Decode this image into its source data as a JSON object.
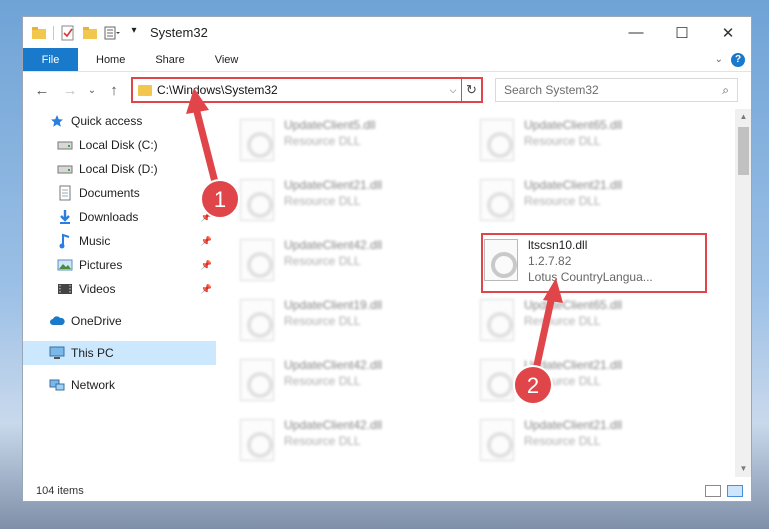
{
  "window": {
    "title": "System32",
    "controls": {
      "minimize": "—",
      "maximize": "☐",
      "close": "✕"
    }
  },
  "ribbon": {
    "file_label": "File",
    "tabs": [
      "Home",
      "Share",
      "View"
    ],
    "help": "?"
  },
  "address": {
    "path": "C:\\Windows\\System32",
    "refresh": "↻",
    "dropdown": "⌵"
  },
  "search": {
    "placeholder": "Search System32",
    "icon": "⌕"
  },
  "nav": {
    "back": "←",
    "forward": "→",
    "recent": "⌄",
    "up": "↑"
  },
  "sidebar": {
    "items": [
      {
        "label": "Quick access",
        "icon": "star-icon"
      },
      {
        "label": "Local Disk (C:)",
        "icon": "drive-icon"
      },
      {
        "label": "Local Disk (D:)",
        "icon": "drive-icon"
      },
      {
        "label": "Documents",
        "icon": "documents-icon"
      },
      {
        "label": "Downloads",
        "icon": "downloads-icon"
      },
      {
        "label": "Music",
        "icon": "music-icon"
      },
      {
        "label": "Pictures",
        "icon": "pictures-icon"
      },
      {
        "label": "Videos",
        "icon": "videos-icon"
      },
      {
        "label": "OneDrive",
        "icon": "cloud-icon"
      },
      {
        "label": "This PC",
        "icon": "computer-icon"
      },
      {
        "label": "Network",
        "icon": "network-icon"
      }
    ],
    "pin": "📌"
  },
  "files": [
    {
      "name": "UpdateClient5.dll",
      "desc": "Resource DLL"
    },
    {
      "name": "UpdateClient65.dll",
      "desc": "Resource DLL"
    },
    {
      "name": "UpdateClient21.dll",
      "desc": "Resource DLL"
    },
    {
      "name": "UpdateClient21.dll",
      "desc": "Resource DLL"
    },
    {
      "name": "UpdateClient42.dll",
      "desc": "Resource DLL"
    },
    {
      "name": "ltscsn10.dll",
      "version": "1.2.7.82",
      "desc": "Lotus CountryLangua..."
    },
    {
      "name": "UpdateClient19.dll",
      "desc": "Resource DLL"
    },
    {
      "name": "UpdateClient65.dll",
      "desc": "Resource DLL"
    },
    {
      "name": "UpdateClient42.dll",
      "desc": "Resource DLL"
    },
    {
      "name": "UpdateClient21.dll",
      "desc": "Resource DLL"
    },
    {
      "name": "UpdateClient42.dll",
      "desc": "Resource DLL"
    },
    {
      "name": "UpdateClient21.dll",
      "desc": "Resource DLL"
    }
  ],
  "status": {
    "count": "104 items"
  },
  "annotations": {
    "badge1": "1",
    "badge2": "2",
    "accent": "#e0454a"
  },
  "colors": {
    "file_tab": "#1979ca",
    "selected": "#cce8ff",
    "highlight": "#e0454a"
  }
}
